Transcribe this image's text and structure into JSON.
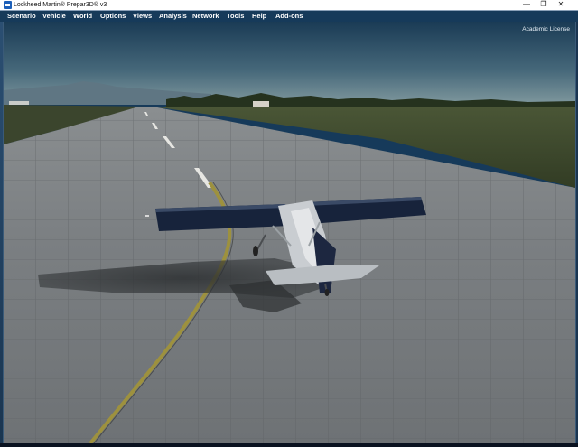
{
  "window": {
    "title": "Lockheed Martin® Prepar3D® v3",
    "controls": {
      "minimize": "—",
      "maximize": "❐",
      "close": "✕"
    }
  },
  "menu": {
    "items": [
      {
        "label": "Scenario"
      },
      {
        "label": "Vehicle"
      },
      {
        "label": "World"
      },
      {
        "label": "Options"
      },
      {
        "label": "Views"
      },
      {
        "label": "Analysis"
      },
      {
        "label": "Network"
      },
      {
        "label": "Tools"
      },
      {
        "label": "Help"
      },
      {
        "label": "Add-ons"
      }
    ]
  },
  "viewport": {
    "license_text": "Academic License"
  },
  "colors": {
    "sky_top": "#1c3f5a",
    "sky_horizon": "#6b8690",
    "runway": "#74787b",
    "grass": "#3d472c",
    "taxi_line": "#a89a3a",
    "wing": "#16223a"
  }
}
